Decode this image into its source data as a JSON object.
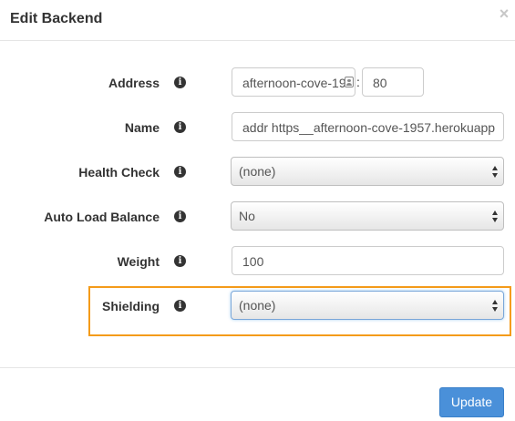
{
  "dialog": {
    "title": "Edit Backend",
    "close_label": "×"
  },
  "form": {
    "address": {
      "label": "Address",
      "host_value": "afternoon-cove-19",
      "separator": ":",
      "port_value": "80"
    },
    "name": {
      "label": "Name",
      "value": "addr https__afternoon-cove-1957.herokuapp"
    },
    "health_check": {
      "label": "Health Check",
      "selected": "(none)"
    },
    "auto_load_balance": {
      "label": "Auto Load Balance",
      "selected": "No"
    },
    "weight": {
      "label": "Weight",
      "value": "100"
    },
    "shielding": {
      "label": "Shielding",
      "selected": "(none)"
    },
    "info_glyph": "i"
  },
  "footer": {
    "update_label": "Update"
  },
  "colors": {
    "highlight_border": "#f49b1a",
    "primary_button": "#4a90d9"
  }
}
